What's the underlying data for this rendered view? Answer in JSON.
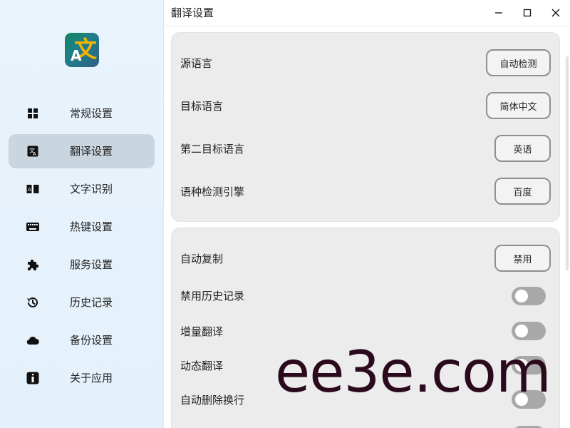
{
  "sidebar": {
    "logo": {
      "glyph_zh": "文",
      "glyph_en": "A"
    },
    "items": [
      {
        "label": "常规设置",
        "icon": "grid-icon",
        "active": false
      },
      {
        "label": "翻译设置",
        "icon": "translate-icon",
        "active": true
      },
      {
        "label": "文字识别",
        "icon": "ocr-icon",
        "active": false
      },
      {
        "label": "热键设置",
        "icon": "keyboard-icon",
        "active": false
      },
      {
        "label": "服务设置",
        "icon": "puzzle-icon",
        "active": false
      },
      {
        "label": "历史记录",
        "icon": "history-icon",
        "active": false
      },
      {
        "label": "备份设置",
        "icon": "cloud-icon",
        "active": false
      },
      {
        "label": "关于应用",
        "icon": "info-icon",
        "active": false
      }
    ]
  },
  "titlebar": {
    "title": "翻译设置",
    "controls": [
      "minimize-icon",
      "maximize-icon",
      "close-icon"
    ]
  },
  "card1": {
    "rows": [
      {
        "label": "源语言",
        "value": "自动检测"
      },
      {
        "label": "目标语言",
        "value": "简体中文"
      },
      {
        "label": "第二目标语言",
        "value": "英语"
      },
      {
        "label": "语种检测引擎",
        "value": "百度"
      }
    ]
  },
  "card2": {
    "auto_copy": {
      "label": "自动复制",
      "value": "禁用"
    },
    "toggles": [
      {
        "label": "禁用历史记录",
        "on": false
      },
      {
        "label": "增量翻译",
        "on": false
      },
      {
        "label": "动态翻译",
        "on": false
      },
      {
        "label": "自动删除换行",
        "on": false
      }
    ]
  },
  "watermark": "ee3e.com",
  "colors": {
    "sidebar_bg": "#e6f2fb",
    "active_item_bg": "#c9d5df",
    "card_bg": "#ececec",
    "toggle_off": "#a8a8a8"
  }
}
